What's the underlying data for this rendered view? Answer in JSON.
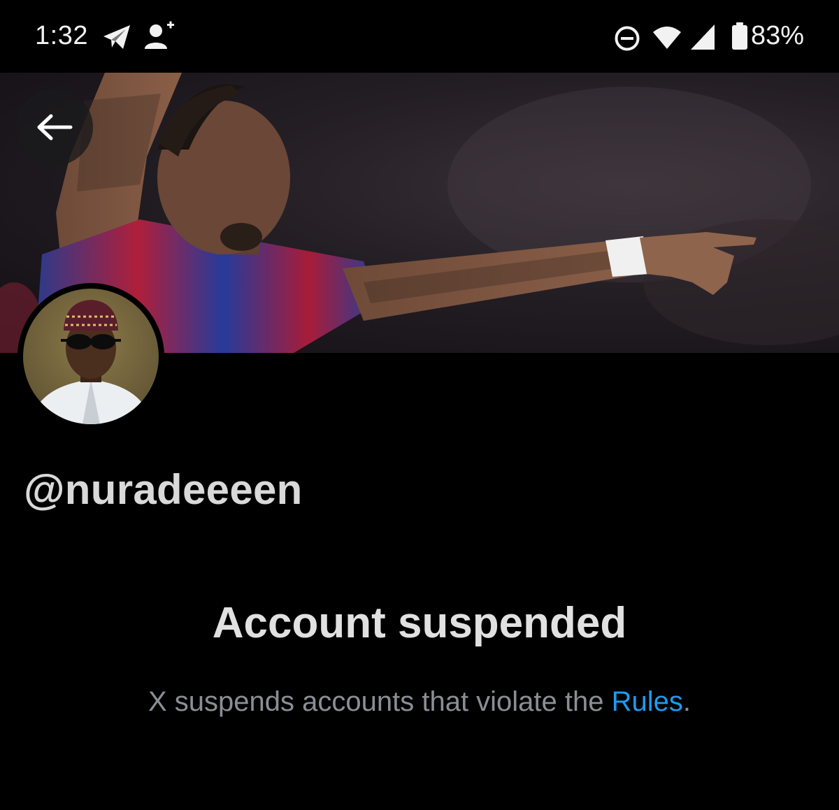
{
  "status_bar": {
    "time": "1:32",
    "battery": "83%",
    "icons": [
      "telegram-icon",
      "add-contact-icon",
      "do-not-disturb-icon",
      "wifi-icon",
      "signal-icon",
      "battery-icon"
    ]
  },
  "profile": {
    "handle": "@nuradeeeen",
    "back_icon": "back-arrow-icon"
  },
  "suspension": {
    "title": "Account suspended",
    "description_prefix": "X suspends accounts that violate the ",
    "rules_link": "Rules",
    "description_suffix": "."
  },
  "colors": {
    "background": "#000000",
    "link": "#1d9bf0",
    "muted_text": "#8b8f94"
  }
}
